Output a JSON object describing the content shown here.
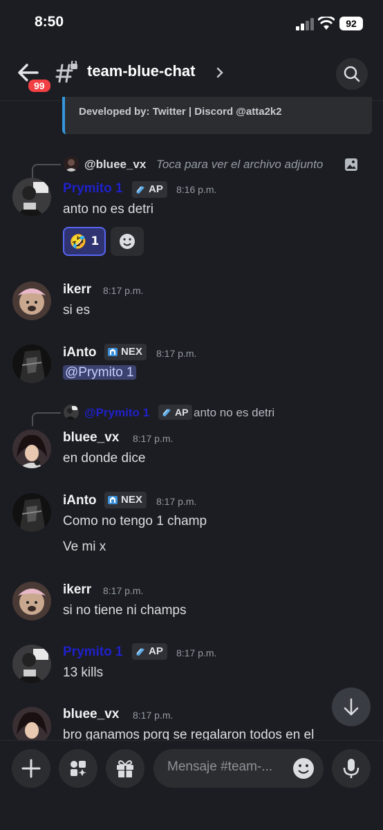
{
  "status_bar": {
    "time": "8:50",
    "battery": "92"
  },
  "header": {
    "back_badge": "99",
    "channel_name": "team-blue-chat"
  },
  "embed": {
    "text": "Developed by: Twitter | Discord @atta2k2"
  },
  "messages": [
    {
      "reply": {
        "name": "@bluee_vx",
        "text": "Toca para ver el archivo adjunto"
      },
      "author": "Prymito 1",
      "author_color": "#1f21c9",
      "tag": "AP",
      "time": "8:16 p.m.",
      "lines": [
        "anto no es detri"
      ],
      "reaction": {
        "emoji": "🤣",
        "count": "1"
      }
    },
    {
      "author": "ikerr",
      "time": "8:17 p.m.",
      "lines": [
        "si es"
      ]
    },
    {
      "author": "iAnto",
      "tag": "NEX",
      "time": "8:17 p.m.",
      "lines": [
        "@Prymito 1"
      ]
    },
    {
      "reply": {
        "name": "@Prymito 1",
        "tag": "AP",
        "text": "anto no es detri"
      },
      "author": "bluee_vx",
      "time": "8:17 p.m.",
      "lines": [
        "en donde dice"
      ]
    },
    {
      "author": "iAnto",
      "tag": "NEX",
      "time": "8:17 p.m.",
      "lines": [
        "Como no tengo 1 champ",
        "Ve mi x"
      ]
    },
    {
      "author": "ikerr",
      "time": "8:17 p.m.",
      "lines": [
        "si no tiene ni champs"
      ]
    },
    {
      "author": "Prymito 1",
      "author_color": "#1f21c9",
      "tag": "AP",
      "time": "8:17 p.m.",
      "lines": [
        "13 kills"
      ]
    },
    {
      "author": "bluee_vx",
      "time": "8:17 p.m.",
      "lines": [
        "bro ganamos porq se regalaron todos en el"
      ]
    }
  ],
  "composer": {
    "placeholder": "Mensaje #team-..."
  },
  "colors": {
    "background": "#1c1d22",
    "accent": "#5865f2",
    "mention_bg": "#3c4270",
    "embed_bar": "#3498db",
    "badge_red": "#f23f43"
  },
  "icons": [
    "back-arrow-icon",
    "hash-lock-icon",
    "chevron-right-icon",
    "search-icon",
    "image-icon",
    "emoji-icon",
    "scroll-down-icon",
    "plus-icon",
    "apps-icon",
    "gift-icon",
    "microphone-icon",
    "ap-tag-icon",
    "nex-tag-icon"
  ]
}
